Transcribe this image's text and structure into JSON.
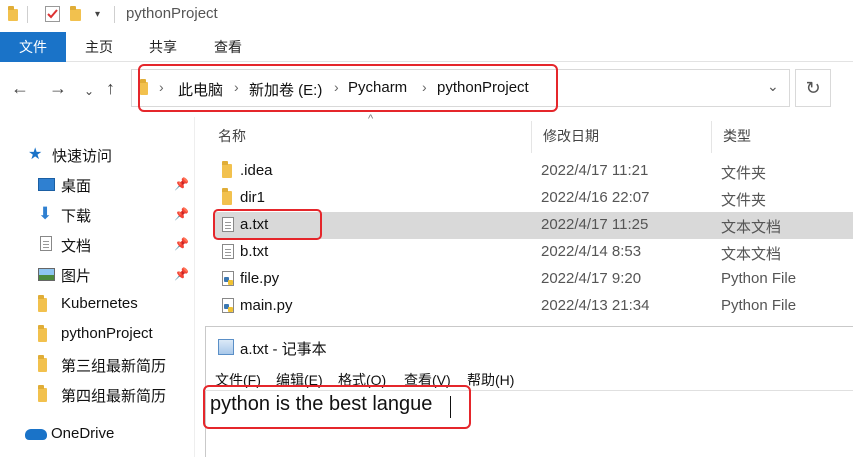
{
  "window": {
    "title": "pythonProject"
  },
  "ribbon": {
    "tabs": [
      "文件",
      "主页",
      "共享",
      "查看"
    ]
  },
  "address": {
    "crumbs": [
      "此电脑",
      "新加卷 (E:)",
      "Pycharm",
      "pythonProject"
    ],
    "dropdown_icon": "chevron-down-icon",
    "refresh_icon": "refresh-icon"
  },
  "nav_pane": {
    "quick_access": "快速访问",
    "items": [
      {
        "label": "桌面",
        "icon": "desktop-icon",
        "pinned": true
      },
      {
        "label": "下载",
        "icon": "download-icon",
        "pinned": true
      },
      {
        "label": "文档",
        "icon": "document-icon",
        "pinned": true
      },
      {
        "label": "图片",
        "icon": "picture-icon",
        "pinned": true
      },
      {
        "label": "Kubernetes",
        "icon": "folder-icon",
        "pinned": false
      },
      {
        "label": "pythonProject",
        "icon": "folder-icon",
        "pinned": false
      },
      {
        "label": "第三组最新简历",
        "icon": "folder-icon",
        "pinned": false
      },
      {
        "label": "第四组最新简历",
        "icon": "folder-icon",
        "pinned": false
      }
    ],
    "onedrive": "OneDrive"
  },
  "file_list": {
    "columns": {
      "name": "名称",
      "date": "修改日期",
      "type": "类型"
    },
    "rows": [
      {
        "name": ".idea",
        "date": "2022/4/17 11:21",
        "type": "文件夹",
        "icon": "folder-icon"
      },
      {
        "name": "dir1",
        "date": "2022/4/16 22:07",
        "type": "文件夹",
        "icon": "folder-icon"
      },
      {
        "name": "a.txt",
        "date": "2022/4/17 11:25",
        "type": "文本文档",
        "icon": "text-file-icon",
        "selected": true
      },
      {
        "name": "b.txt",
        "date": "2022/4/14 8:53",
        "type": "文本文档",
        "icon": "text-file-icon"
      },
      {
        "name": "file.py",
        "date": "2022/4/17 9:20",
        "type": "Python File",
        "icon": "python-file-icon"
      },
      {
        "name": "main.py",
        "date": "2022/4/13 21:34",
        "type": "Python File",
        "icon": "python-file-icon"
      }
    ]
  },
  "notepad": {
    "title": "a.txt - 记事本",
    "menu": [
      "文件(F)",
      "编辑(E)",
      "格式(O)",
      "查看(V)",
      "帮助(H)"
    ],
    "content": "python is the best langue"
  },
  "colors": {
    "highlight": "#e5262b",
    "accent": "#1a73c8",
    "selected_row": "#d9d9d9"
  }
}
